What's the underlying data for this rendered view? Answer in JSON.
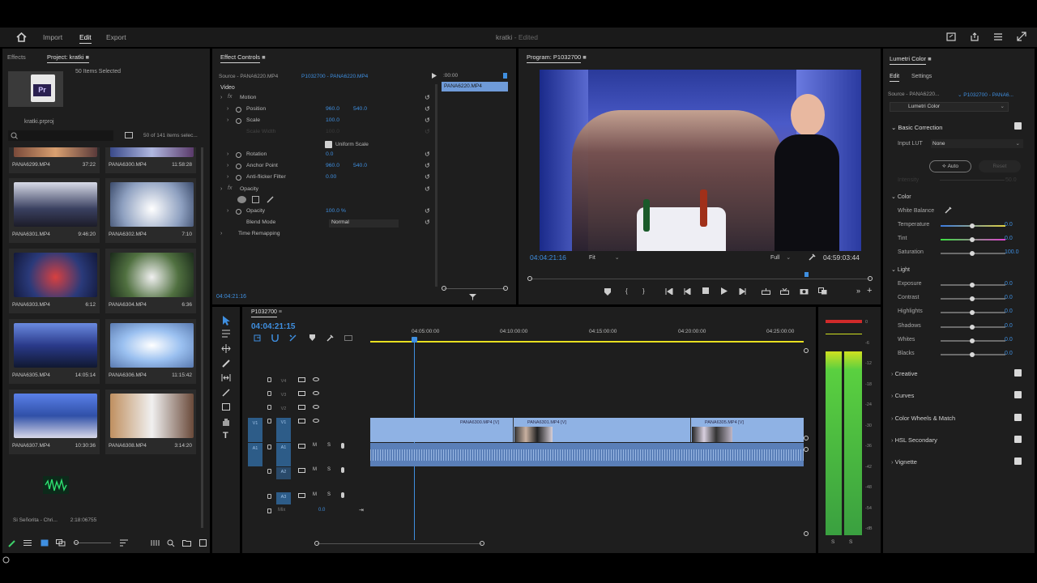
{
  "topbar": {
    "nav": [
      "Import",
      "Edit",
      "Export"
    ],
    "active": "Edit",
    "title": "kratki",
    "status": "- Edited"
  },
  "project": {
    "tabs": [
      "Effects",
      "Project: kratki"
    ],
    "items_selected": "50 Items Selected",
    "app_badge": "Pr",
    "file": "kratki.prproj",
    "count": "50 of 141 items selec...",
    "clips": [
      {
        "name": "PANA6299.MP4",
        "dur": "37:22"
      },
      {
        "name": "PANA6300.MP4",
        "dur": "11:58:28"
      },
      {
        "name": "PANA6301.MP4",
        "dur": "9:46:20"
      },
      {
        "name": "PANA6302.MP4",
        "dur": "7:10"
      },
      {
        "name": "PANA6303.MP4",
        "dur": "6:12"
      },
      {
        "name": "PANA6304.MP4",
        "dur": "6:36"
      },
      {
        "name": "PANA6305.MP4",
        "dur": "14:05:14"
      },
      {
        "name": "PANA6306.MP4",
        "dur": "11:15:42"
      },
      {
        "name": "PANA6307.MP4",
        "dur": "10:30:36"
      },
      {
        "name": "PANA6308.MP4",
        "dur": "3:14:20"
      }
    ],
    "audio_clip": {
      "name": "Si Señorita - Chri...",
      "dur": "2:18:06755"
    }
  },
  "effect_controls": {
    "tab": "Effect Controls",
    "source": "Source - PANA6220.MP4",
    "seq": "P1032700 - PANA6220.MP4",
    "video_label": "Video",
    "tc_ruler": ":00:00",
    "clip_bar": "PANA6220.MP4",
    "rows": [
      {
        "name": "Motion",
        "v1": "",
        "v2": "",
        "kind": "group"
      },
      {
        "name": "Position",
        "v1": "960.0",
        "v2": "540.0",
        "kind": "prop"
      },
      {
        "name": "Scale",
        "v1": "100.0",
        "v2": "",
        "kind": "prop"
      },
      {
        "name": "Scale Width",
        "v1": "100.0",
        "v2": "",
        "kind": "dim"
      },
      {
        "name": "Rotation",
        "v1": "0.0",
        "v2": "",
        "kind": "prop"
      },
      {
        "name": "Anchor Point",
        "v1": "960.0",
        "v2": "540.0",
        "kind": "prop"
      },
      {
        "name": "Anti-flicker Filter",
        "v1": "0.00",
        "v2": "",
        "kind": "prop"
      },
      {
        "name": "Opacity",
        "v1": "",
        "v2": "",
        "kind": "group"
      },
      {
        "name": "Opacity",
        "v1": "100.0 %",
        "v2": "",
        "kind": "prop"
      },
      {
        "name": "Blend Mode",
        "v1": "Normal",
        "v2": "",
        "kind": "prop"
      },
      {
        "name": "Time Remapping",
        "v1": "",
        "v2": "",
        "kind": "group"
      }
    ],
    "uniform_scale": "Uniform Scale",
    "timecode": "04:04:21:16"
  },
  "program": {
    "tab": "Program: P1032700",
    "timecode": "04:04:21:16",
    "fit": "Fit",
    "quality": "Full",
    "duration": "04:59:03:44"
  },
  "timeline": {
    "tab": "P1032700",
    "timecode": "04:04:21:15",
    "ruler": [
      "04:05:00:00",
      "04:10:00:00",
      "04:15:00:00",
      "04:20:00:00",
      "04:25:00:00"
    ],
    "tracks": [
      {
        "name": "V4",
        "src": ""
      },
      {
        "name": "V3",
        "src": ""
      },
      {
        "name": "V2",
        "src": ""
      },
      {
        "name": "V1",
        "src": "V1"
      },
      {
        "name": "A1",
        "src": "A1"
      },
      {
        "name": "A2",
        "src": ""
      },
      {
        "name": "A3",
        "src": ""
      }
    ],
    "mix_label": "Mix",
    "mix_value": "0.0",
    "clips": [
      "PANA6300.MP4 [V]",
      "PANA6301.MP4 [V]",
      "PANA6305.MP4 [V]"
    ]
  },
  "meter": {
    "scale": [
      "0",
      "-6",
      "-12",
      "-18",
      "-24",
      "-30",
      "-36",
      "-42",
      "-48",
      "-54",
      "-dB"
    ],
    "channels": [
      "S",
      "S"
    ]
  },
  "lumetri": {
    "tab": "Lumetri Color",
    "subtabs": [
      "Edit",
      "Settings"
    ],
    "source": "Source - PANA6220...",
    "seq": "P1032700 - PANA6...",
    "effect": "Lumetri Color",
    "basic": "Basic Correction",
    "input_lut_label": "Input LUT",
    "input_lut": "None",
    "auto": "Auto",
    "reset": "Reset",
    "intensity": "Intensity",
    "intensity_val": "50.0",
    "color": "Color",
    "white_balance": "White Balance",
    "color_rows": [
      {
        "name": "Temperature",
        "val": "0.0"
      },
      {
        "name": "Tint",
        "val": "0.0"
      },
      {
        "name": "Saturation",
        "val": "100.0"
      }
    ],
    "light": "Light",
    "light_rows": [
      {
        "name": "Exposure",
        "val": "0.0"
      },
      {
        "name": "Contrast",
        "val": "0.0"
      },
      {
        "name": "Highlights",
        "val": "0.0"
      },
      {
        "name": "Shadows",
        "val": "0.0"
      },
      {
        "name": "Whites",
        "val": "0.0"
      },
      {
        "name": "Blacks",
        "val": "0.0"
      }
    ],
    "sections": [
      "Creative",
      "Curves",
      "Color Wheels & Match",
      "HSL Secondary",
      "Vignette"
    ]
  }
}
